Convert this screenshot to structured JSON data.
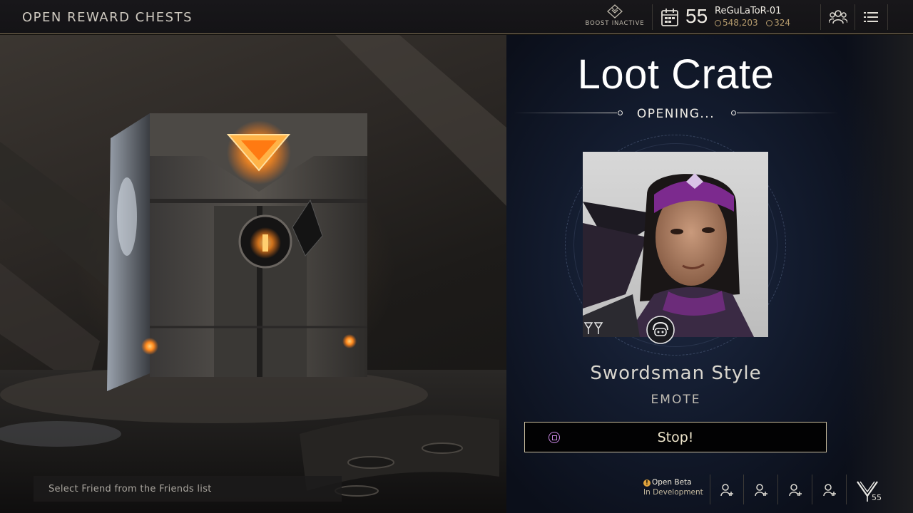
{
  "header": {
    "page_title": "OPEN REWARD CHESTS",
    "boost_label": "BOOST INACTIVE",
    "player_level": "55",
    "player_name": "ReGuLaToR-01",
    "currency_primary": "548,203",
    "currency_secondary": "324",
    "icons": [
      "boost-icon",
      "calendar-icon",
      "friends-icon",
      "menu-icon"
    ]
  },
  "crate": {
    "title": "Loot Crate",
    "status": "OPENING...",
    "reward_name": "Swordsman Style",
    "reward_type": "EMOTE",
    "action_label": "Stop!",
    "action_icon": "square-button-icon"
  },
  "friends": {
    "select_placeholder": "Select Friend from the Friends list",
    "slots": 4
  },
  "footer": {
    "beta_title": "Open Beta",
    "beta_subtitle": "In Development",
    "rank_number": "55"
  },
  "colors": {
    "accent_gold": "#c9bd9e",
    "currency_gold": "#b79d6e",
    "button_icon_purple": "#c986e3",
    "panel_blue": "#1e2a44"
  }
}
